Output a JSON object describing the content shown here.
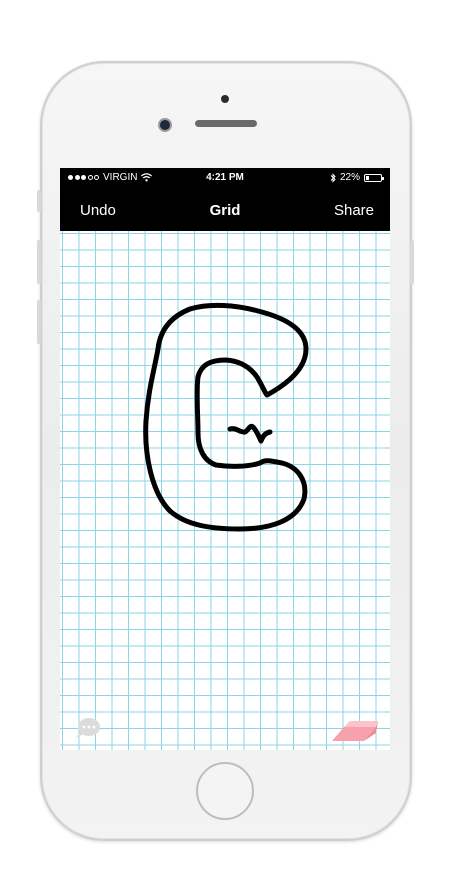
{
  "status_bar": {
    "carrier": "VIRGIN",
    "time": "4:21 PM",
    "battery": "22%",
    "battery_level": 0.22
  },
  "nav_bar": {
    "left_label": "Undo",
    "title": "Grid",
    "right_label": "Share"
  },
  "canvas": {
    "grid_color": "#8fd3e6",
    "stroke_color": "#000000"
  },
  "toolbar": {
    "left_icon": "chat-bubble-icon",
    "right_icon": "eraser-icon",
    "eraser_color": "#f7a1ad"
  }
}
